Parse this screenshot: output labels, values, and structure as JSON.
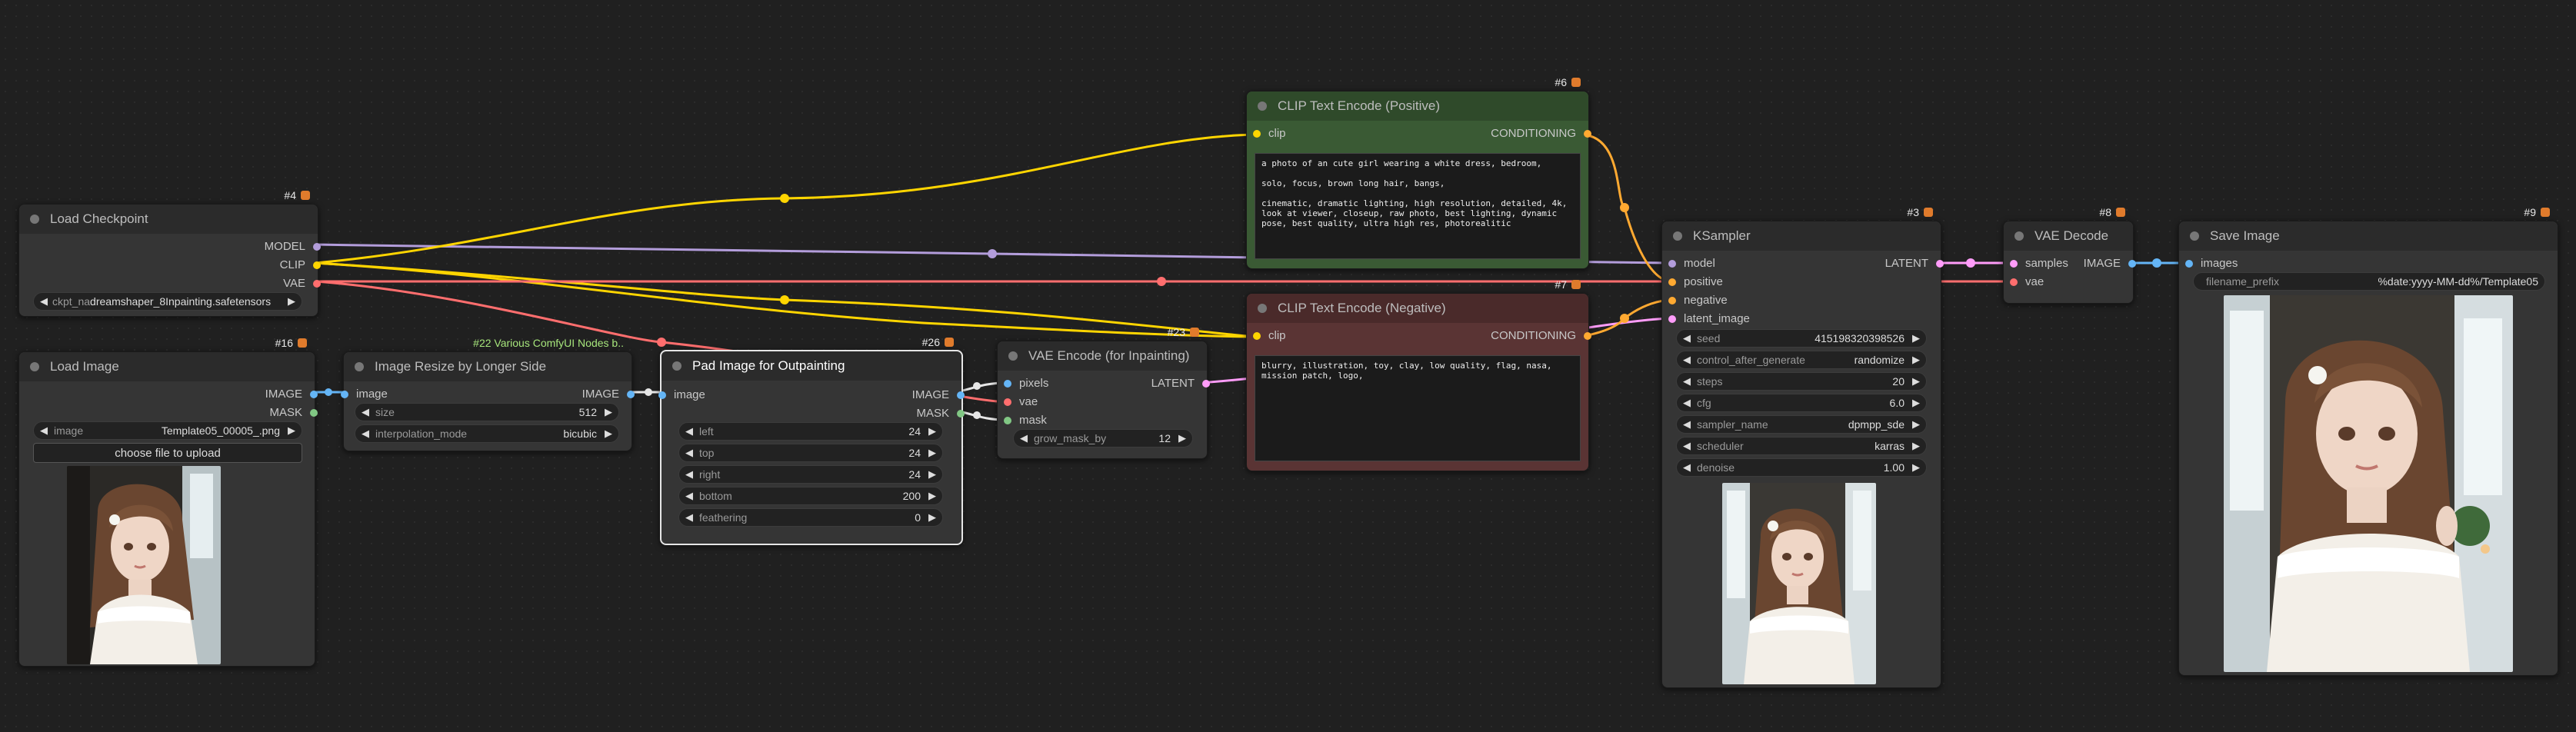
{
  "nodes": {
    "load_checkpoint": {
      "id": "#4",
      "title": "Load Checkpoint",
      "outputs": [
        "MODEL",
        "CLIP",
        "VAE"
      ],
      "ckpt_label": "ckpt_na",
      "ckpt_value": "dreamshaper_8Inpainting.safetensors"
    },
    "load_image": {
      "id": "#16",
      "title": "Load Image",
      "outputs": [
        "IMAGE",
        "MASK"
      ],
      "image_label": "image",
      "image_value": "Template05_00005_.png",
      "upload_label": "choose file to upload"
    },
    "image_resize": {
      "id": "#22 Various ComfyUI Nodes b..",
      "title": "Image Resize by Longer Side",
      "input": "image",
      "output": "IMAGE",
      "widgets": [
        {
          "label": "size",
          "value": "512"
        },
        {
          "label": "interpolation_mode",
          "value": "bicubic"
        }
      ]
    },
    "pad_image": {
      "id": "#26",
      "title": "Pad Image for Outpainting",
      "input": "image",
      "outputs": [
        "IMAGE",
        "MASK"
      ],
      "widgets": [
        {
          "label": "left",
          "value": "24"
        },
        {
          "label": "top",
          "value": "24"
        },
        {
          "label": "right",
          "value": "24"
        },
        {
          "label": "bottom",
          "value": "200"
        },
        {
          "label": "feathering",
          "value": "0"
        }
      ]
    },
    "vae_encode": {
      "id": "#23",
      "title": "VAE Encode (for Inpainting)",
      "inputs": [
        "pixels",
        "vae",
        "mask"
      ],
      "output": "LATENT",
      "widget": {
        "label": "grow_mask_by",
        "value": "12"
      }
    },
    "clip_pos": {
      "id": "#6",
      "title": "CLIP Text Encode (Positive)",
      "input": "clip",
      "output": "CONDITIONING",
      "text": "a photo of an cute girl wearing a white dress, bedroom,\n\nsolo, focus, brown long hair, bangs,\n\ncinematic, dramatic lighting, high resolution, detailed, 4k,\nlook at viewer, closeup, raw photo, best lighting, dynamic\npose, best quality, ultra high res, photorealitic"
    },
    "clip_neg": {
      "id": "#7",
      "title": "CLIP Text Encode (Negative)",
      "input": "clip",
      "output": "CONDITIONING",
      "text": "blurry, illustration, toy, clay, low quality, flag, nasa,\nmission patch, logo,"
    },
    "ksampler": {
      "id": "#3",
      "title": "KSampler",
      "inputs": [
        "model",
        "positive",
        "negative",
        "latent_image"
      ],
      "output": "LATENT",
      "widgets": [
        {
          "label": "seed",
          "value": "415198320398526"
        },
        {
          "label": "control_after_generate",
          "value": "randomize"
        },
        {
          "label": "steps",
          "value": "20"
        },
        {
          "label": "cfg",
          "value": "6.0"
        },
        {
          "label": "sampler_name",
          "value": "dpmpp_sde"
        },
        {
          "label": "scheduler",
          "value": "karras"
        },
        {
          "label": "denoise",
          "value": "1.00"
        }
      ]
    },
    "vae_decode": {
      "id": "#8",
      "title": "VAE Decode",
      "inputs": [
        "samples",
        "vae"
      ],
      "output": "IMAGE"
    },
    "save_image": {
      "id": "#9",
      "title": "Save Image",
      "input": "images",
      "prefix_label": "filename_prefix",
      "prefix_value": "%date:yyyy-MM-dd%/Template05"
    }
  },
  "colors": {
    "model": "#b39ddb",
    "clip": "#ffd500",
    "vae": "#ff6e6e",
    "image": "#64b5f6",
    "mask": "#81c784",
    "latent": "#ff9cf9",
    "conditioning": "#ffa931",
    "pos_header": "#2f4a2a",
    "neg_header": "#4a2a2a"
  }
}
